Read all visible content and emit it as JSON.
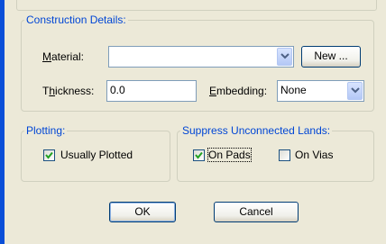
{
  "construction": {
    "legend": "Construction Details:",
    "material_label": "Material:",
    "material_value": "",
    "new_button": "New ...",
    "thickness_label": "Thickness:",
    "thickness_value": "0.0",
    "embedding_label": "Embedding:",
    "embedding_value": "None"
  },
  "plotting": {
    "legend": "Plotting:",
    "usually_plotted": {
      "label": "Usually Plotted",
      "checked": true
    }
  },
  "suppress": {
    "legend": "Suppress Unconnected Lands:",
    "on_pads": {
      "label": "On Pads",
      "checked": true
    },
    "on_vias": {
      "label": "On Vias",
      "checked": false
    }
  },
  "buttons": {
    "ok": "OK",
    "cancel": "Cancel"
  },
  "colors": {
    "legend": "#0046d5",
    "accent_bar": "#0a4fd8",
    "check": "#21a121"
  },
  "icons": {
    "dropdown": "chevron-down-icon",
    "check": "checkmark-icon"
  }
}
